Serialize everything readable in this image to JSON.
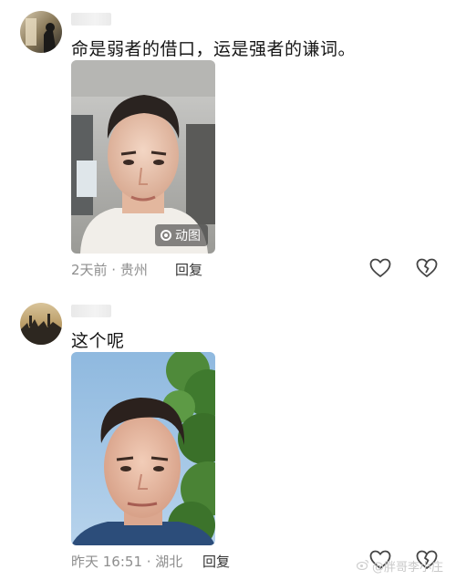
{
  "comments": [
    {
      "text": "命是弱者的借口，运是强者的谦词。",
      "gif_badge": "动图",
      "location_time": "2天前 · 贵州",
      "reply_label": "回复",
      "like_icon": "heart-outline-icon",
      "dislike_icon": "broken-heart-icon"
    },
    {
      "text": "这个呢",
      "location_time": "昨天 16:51 · 湖北",
      "reply_label": "回复",
      "like_icon": "heart-outline-icon",
      "dislike_icon": "broken-heart-icon"
    }
  ],
  "watermark": "@胖哥李小庄"
}
